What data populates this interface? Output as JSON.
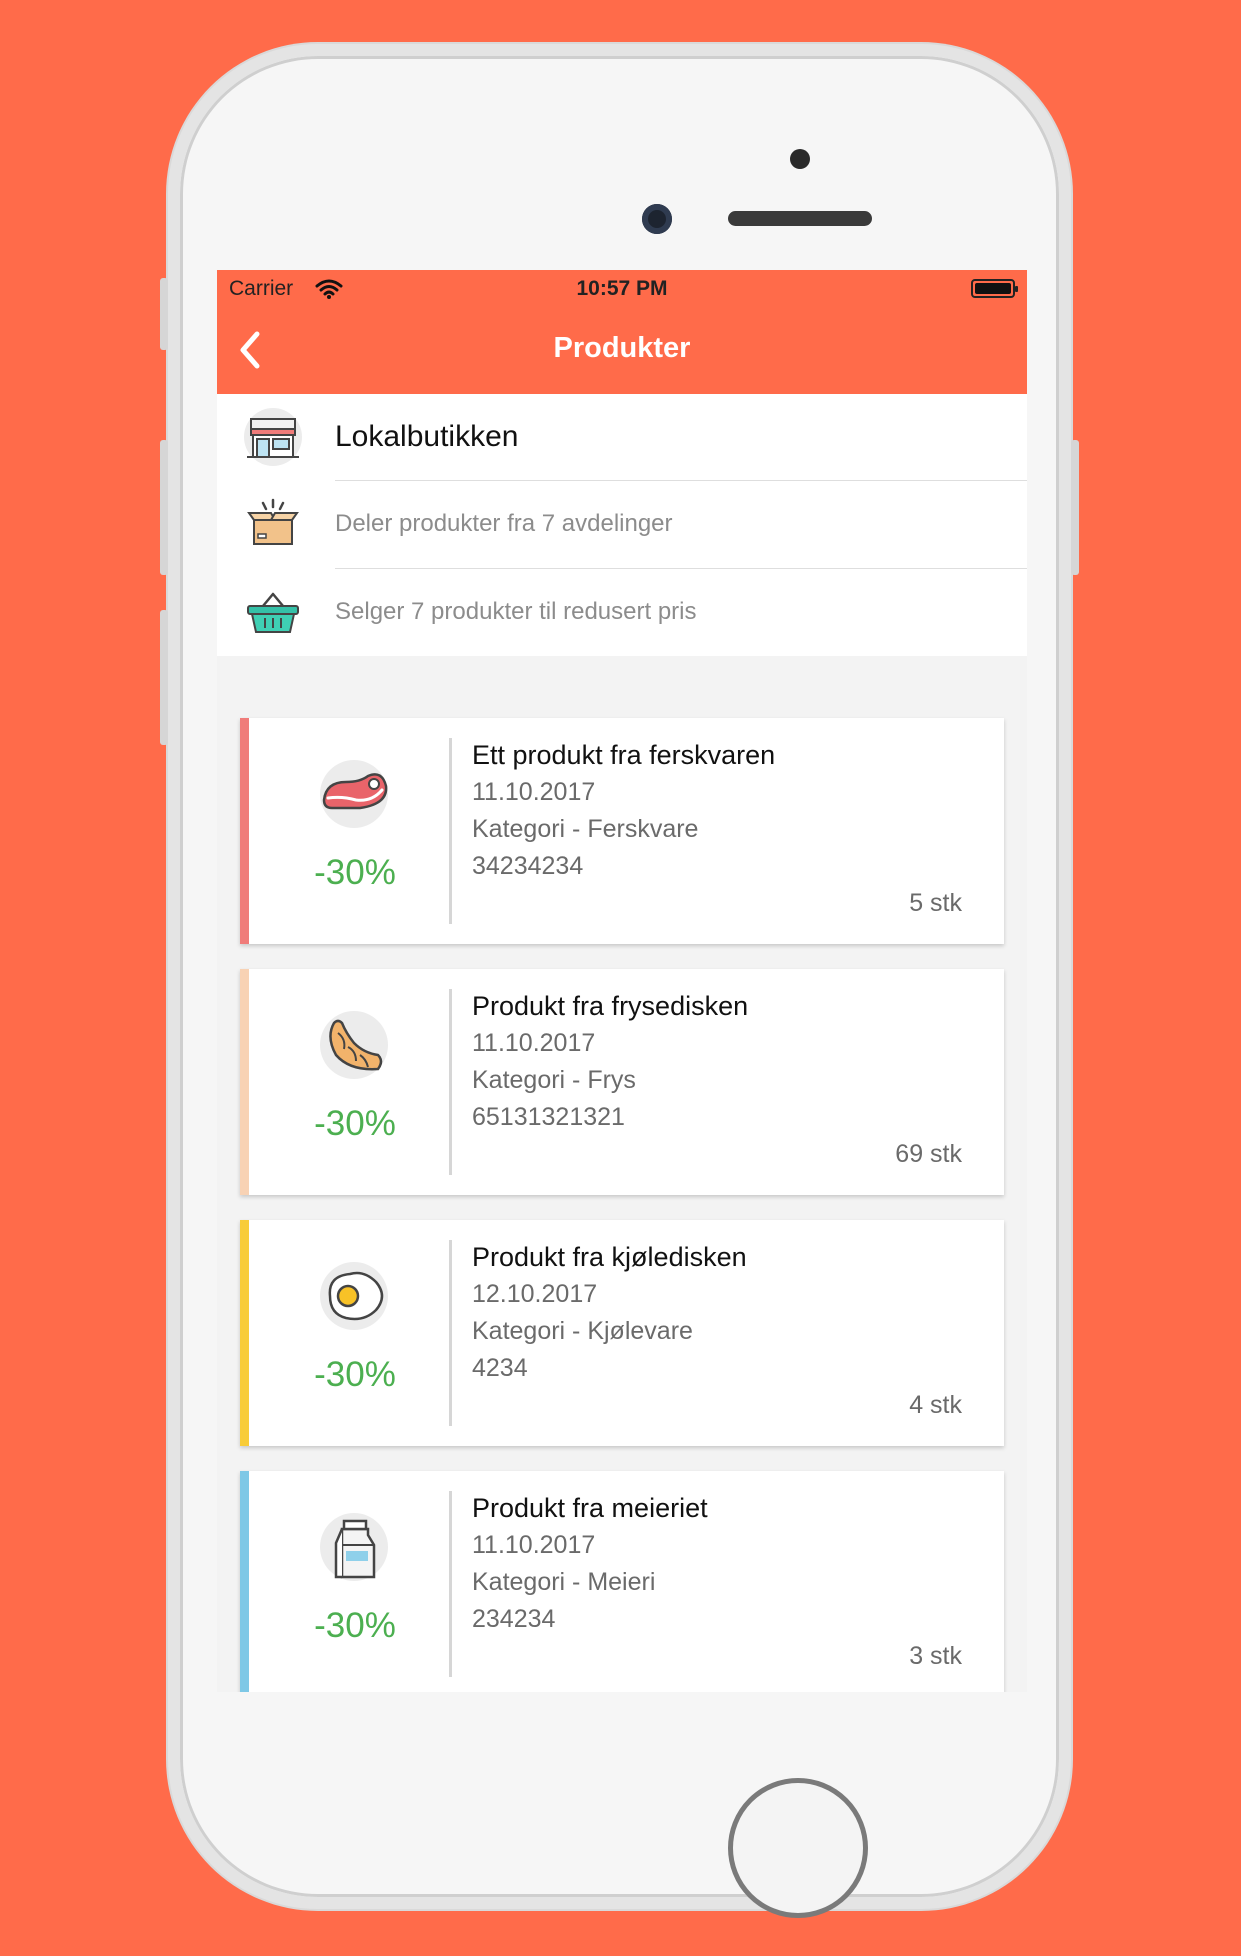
{
  "status_bar": {
    "carrier": "Carrier",
    "time": "10:57 PM"
  },
  "nav": {
    "title": "Produkter",
    "back_icon": "chevron-left-icon"
  },
  "store": {
    "name": "Lokalbutikken",
    "departments_text": "Deler produkter fra 7 avdelinger",
    "discount_text": "Selger 7 produkter til redusert pris"
  },
  "products": [
    {
      "name": "Ett produkt fra ferskvaren",
      "date": "11.10.2017",
      "category": "Kategori - Ferskvare",
      "code": "34234234",
      "quantity": "5 stk",
      "discount": "-30%",
      "icon": "steak-icon",
      "accent": "#f07c7a"
    },
    {
      "name": "Produkt fra frysedisken",
      "date": "11.10.2017",
      "category": "Kategori - Frys",
      "code": "65131321321",
      "quantity": "69 stk",
      "discount": "-30%",
      "icon": "croissant-icon",
      "accent": "#f8d2b4"
    },
    {
      "name": "Produkt fra kjøledisken",
      "date": "12.10.2017",
      "category": "Kategori - Kjølevare",
      "code": "4234",
      "quantity": "4 stk",
      "discount": "-30%",
      "icon": "fried-egg-icon",
      "accent": "#f8cc38"
    },
    {
      "name": "Produkt fra meieriet",
      "date": "11.10.2017",
      "category": "Kategori - Meieri",
      "code": "234234",
      "quantity": "3 stk",
      "discount": "-30%",
      "icon": "milk-carton-icon",
      "accent": "#7ec8e6"
    }
  ],
  "colors": {
    "brand": "#ff6b4a",
    "discount": "#4caf50"
  }
}
